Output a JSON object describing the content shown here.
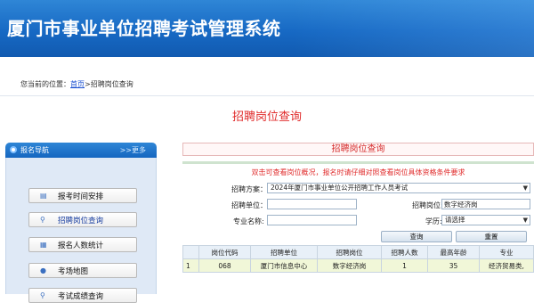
{
  "header": {
    "title": "厦门市事业单位招聘考试管理系统"
  },
  "breadcrumb": {
    "prefix": "您当前的位置：",
    "home": "首页",
    "current": ">招聘岗位查询"
  },
  "page_title": "招聘岗位查询",
  "sidebar": {
    "heading": "报名导航",
    "more": ">>更多",
    "items": [
      {
        "label": "报考时间安排",
        "icon": "document-icon"
      },
      {
        "label": "招聘岗位查询",
        "icon": "search-icon"
      },
      {
        "label": "报名人数统计",
        "icon": "stats-icon"
      },
      {
        "label": "考场地图",
        "icon": "map-icon"
      },
      {
        "label": "考试成绩查询",
        "icon": "search-icon"
      }
    ]
  },
  "panel": {
    "title": "招聘岗位查询",
    "notice": "双击可查看岗位概况，报名时请仔细对照查看岗位具体资格条件要求",
    "form": {
      "plan_label": "招聘方案：",
      "plan_value": "2024年厦门市事业单位公开招聘工作人员考试",
      "unit_label": "招聘单位：",
      "unit_value": "",
      "position_label": "招聘岗位:",
      "position_value": "数字经济岗",
      "major_label": "专业名称:",
      "major_value": "",
      "education_label": "学历:",
      "education_value": "请选择",
      "search_button": "查询",
      "reset_button": "重置"
    },
    "table": {
      "columns": [
        "",
        "岗位代码",
        "招聘单位",
        "招聘岗位",
        "招聘人数",
        "最高年龄",
        "专业"
      ],
      "rows": [
        [
          "1",
          "068",
          "厦门市信息中心",
          "数字经济岗",
          "1",
          "35",
          "经济贸易类,"
        ]
      ]
    }
  }
}
